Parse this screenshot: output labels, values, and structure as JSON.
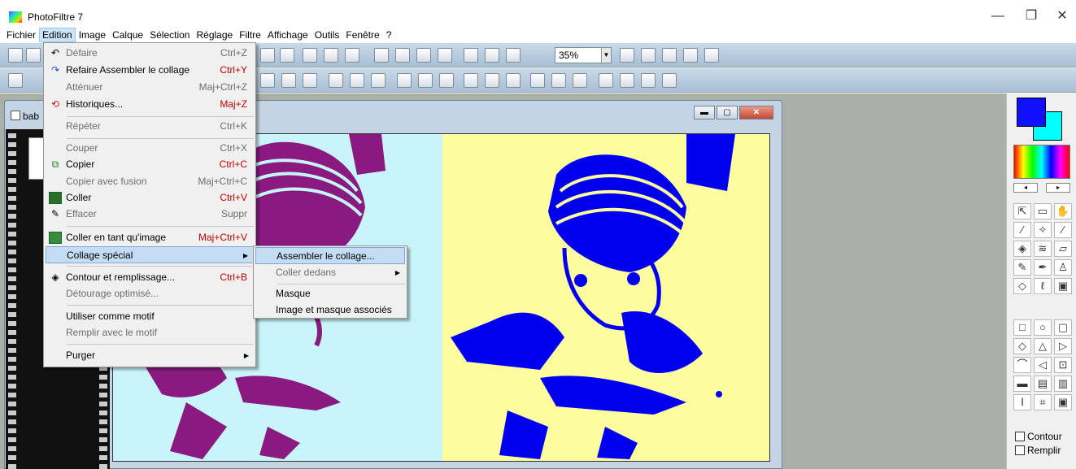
{
  "window": {
    "title": "PhotoFiltre 7",
    "min_glyph": "—",
    "max_glyph": "❐",
    "close_glyph": "✕"
  },
  "menubar": {
    "items": [
      "Fichier",
      "Edition",
      "Image",
      "Calque",
      "Sélection",
      "Réglage",
      "Filtre",
      "Affichage",
      "Outils",
      "Fenêtre",
      "?"
    ]
  },
  "toolbar": {
    "zoom_value": "35%"
  },
  "document": {
    "title": "bab"
  },
  "edit_menu": {
    "items": [
      {
        "label": "Défaire",
        "shortcut": "Ctrl+Z",
        "icon": "undo-icon",
        "glyph": "↶",
        "enabled": false
      },
      {
        "label": "Refaire Assembler le collage",
        "shortcut": "Ctrl+Y",
        "icon": "redo-icon",
        "glyph": "↷",
        "enabled": true
      },
      {
        "label": "Atténuer",
        "shortcut": "Maj+Ctrl+Z",
        "enabled": false
      },
      {
        "label": "Historiques...",
        "shortcut": "Maj+Z",
        "icon": "history-icon",
        "glyph": "⟲",
        "enabled": true
      },
      {
        "label": "Répéter",
        "shortcut": "Ctrl+K",
        "enabled": false
      },
      {
        "label": "Couper",
        "shortcut": "Ctrl+X",
        "enabled": false
      },
      {
        "label": "Copier",
        "shortcut": "Ctrl+C",
        "icon": "copy-icon",
        "glyph": "⧉",
        "enabled": true
      },
      {
        "label": "Copier avec fusion",
        "shortcut": "Maj+Ctrl+C",
        "enabled": false
      },
      {
        "label": "Coller",
        "shortcut": "Ctrl+V",
        "icon": "paste-icon",
        "glyph": "📋",
        "enabled": true
      },
      {
        "label": "Effacer",
        "shortcut": "Suppr",
        "icon": "eraser-icon",
        "glyph": "✎",
        "enabled": false
      },
      {
        "label": "Coller en tant qu'image",
        "shortcut": "Maj+Ctrl+V",
        "icon": "paste-image-icon",
        "glyph": "🖼",
        "enabled": true
      },
      {
        "label": "Collage spécial",
        "shortcut": "",
        "submenu": true,
        "enabled": true
      },
      {
        "label": "Contour et remplissage...",
        "shortcut": "Ctrl+B",
        "icon": "fill-icon",
        "glyph": "◈",
        "enabled": true
      },
      {
        "label": "Détourage optimisé...",
        "shortcut": "",
        "enabled": false
      },
      {
        "label": "Utiliser comme motif",
        "shortcut": "",
        "enabled": true
      },
      {
        "label": "Remplir avec le motif",
        "shortcut": "",
        "enabled": false
      },
      {
        "label": "Purger",
        "shortcut": "",
        "submenu": true,
        "enabled": true
      }
    ]
  },
  "submenu": {
    "items": [
      {
        "label": "Assembler le collage...",
        "enabled": true,
        "highlighted": true
      },
      {
        "label": "Coller dedans",
        "enabled": false,
        "submenu": true
      },
      {
        "label": "Masque",
        "enabled": true
      },
      {
        "label": "Image et masque associés",
        "enabled": true
      }
    ]
  },
  "right_panel": {
    "foreground_color": "#1010ff",
    "background_color": "#00ffff",
    "contour_label": "Contour",
    "remplir_label": "Remplir"
  },
  "canvas": {
    "left_bg": "#c8f4fb",
    "right_bg": "#fdfda0",
    "left_ink": "#8b1a80",
    "right_ink": "#0000ee"
  }
}
